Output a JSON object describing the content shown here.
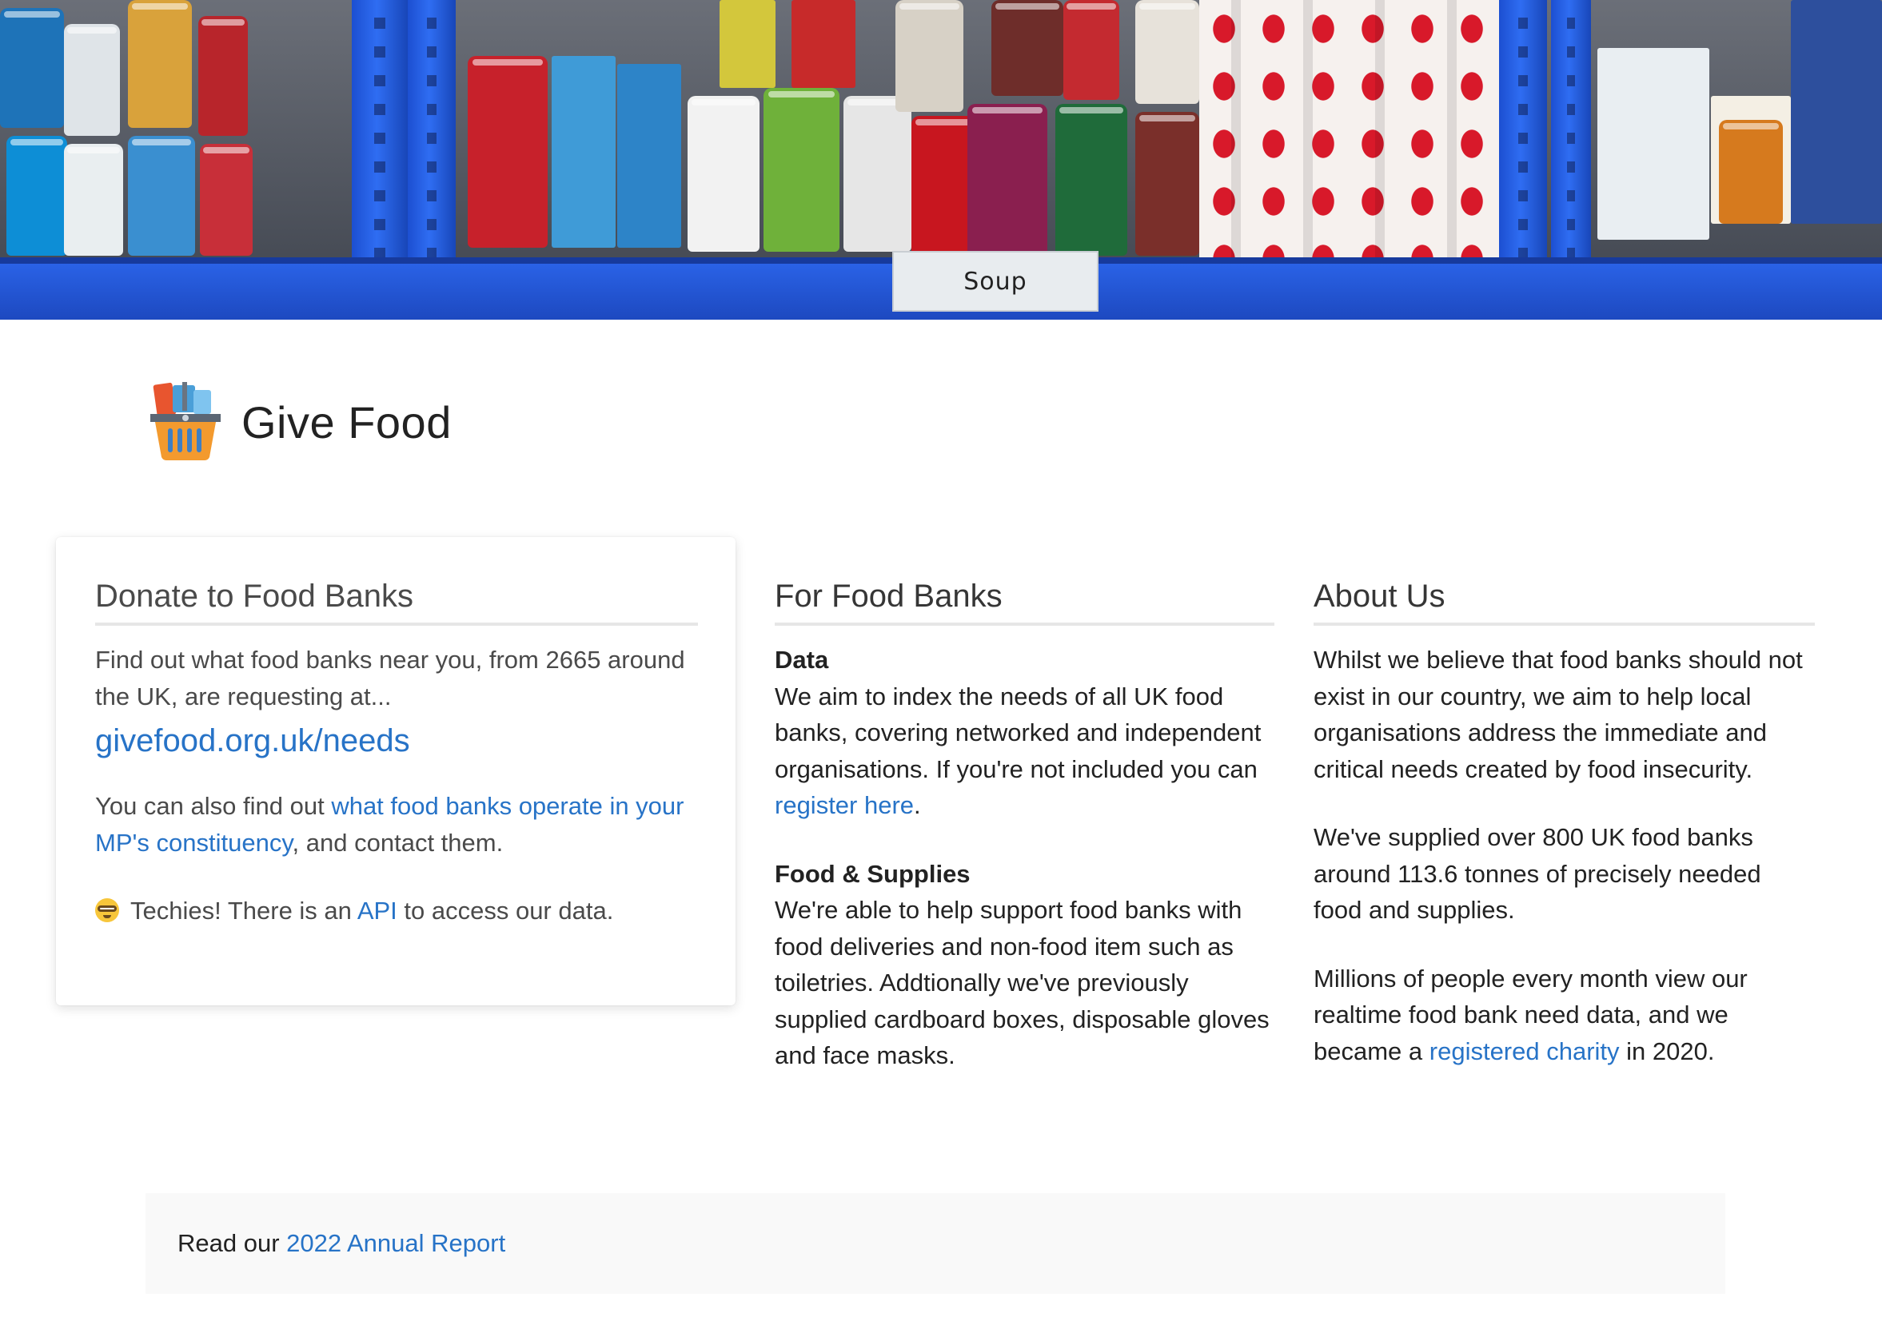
{
  "hero": {
    "shelf_label": "Soup"
  },
  "header": {
    "title": "Give Food",
    "logo_icon": "shopping-basket-icon"
  },
  "donate": {
    "heading": "Donate to Food Banks",
    "intro": "Find out what food banks near you, from 2665 around the UK, are requesting at...",
    "needs_link": "givefood.org.uk/needs",
    "mp_prefix": "You can also find out ",
    "mp_link": "what food banks operate in your MP's constituency",
    "mp_suffix": ", and contact them.",
    "techies_icon": "nerd-face-icon",
    "techies_prefix": " Techies! There is an ",
    "api_link": "API",
    "techies_suffix": " to access our data."
  },
  "for_food_banks": {
    "heading": "For Food Banks",
    "data_title": "Data",
    "data_text": "We aim to index the needs of all UK food banks, covering networked and independent organisations. If you're not included you can ",
    "register_link": "register here",
    "register_suffix": ".",
    "supplies_title": "Food & Supplies",
    "supplies_text": "We're able to help support food banks with food deliveries and non-food item such as toiletries. Addtionally we've previously supplied cardboard boxes, disposable gloves and face masks."
  },
  "about": {
    "heading": "About Us",
    "p1": "Whilst we believe that food banks should not exist in our country, we aim to help local organisations address the immediate and critical needs created by food insecurity.",
    "p2": "We've supplied over 800 UK food banks around 113.6 tonnes of precisely needed food and supplies.",
    "p3_prefix": "Millions of people every month view our realtime food bank need data, and we became a ",
    "charity_link": "registered charity",
    "p3_suffix": " in 2020."
  },
  "report": {
    "prefix": "Read our ",
    "link": "2022 Annual Report"
  },
  "colors": {
    "link": "#2773c7",
    "text": "#222222",
    "muted_text": "#4a4a4a",
    "rule": "#e6e6e6",
    "report_bg": "#f9f9f9",
    "shelf_blue": "#2f6df2"
  }
}
